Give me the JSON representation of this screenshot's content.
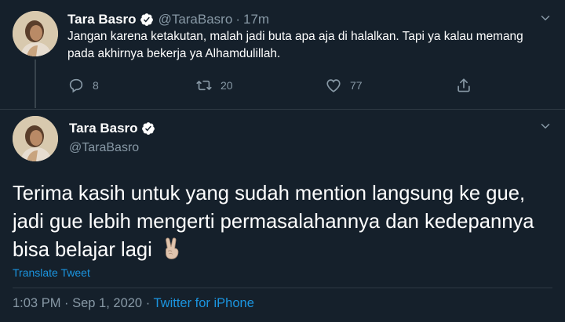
{
  "reply_tweet": {
    "display_name": "Tara Basro",
    "handle": "@TaraBasro",
    "separator": "·",
    "time": "17m",
    "text": "Jangan karena ketakutan, malah jadi buta apa aja di halalkan. Tapi ya kalau memang pada akhirnya bekerja ya Alhamdulillah.",
    "actions": {
      "reply_count": "8",
      "retweet_count": "20",
      "like_count": "77"
    },
    "icons": [
      "reply-icon",
      "retweet-icon",
      "like-icon",
      "share-icon",
      "chevron-down-icon",
      "verified-badge-icon"
    ]
  },
  "main_tweet": {
    "display_name": "Tara Basro",
    "handle": "@TaraBasro",
    "text": "Terima kasih untuk yang sudah mention langsung ke gue, jadi gue lebih mengerti permasalahannya dan kedepannya bisa belajar lagi",
    "emoji": "victory-hand-emoji",
    "translate_label": "Translate Tweet",
    "timestamp": "1:03 PM · Sep 1, 2020 ·",
    "source": "Twitter for iPhone"
  },
  "colors": {
    "background": "#15202b",
    "secondary_text": "#8899a6",
    "accent": "#1b95e0",
    "verified": "#ffffff"
  }
}
